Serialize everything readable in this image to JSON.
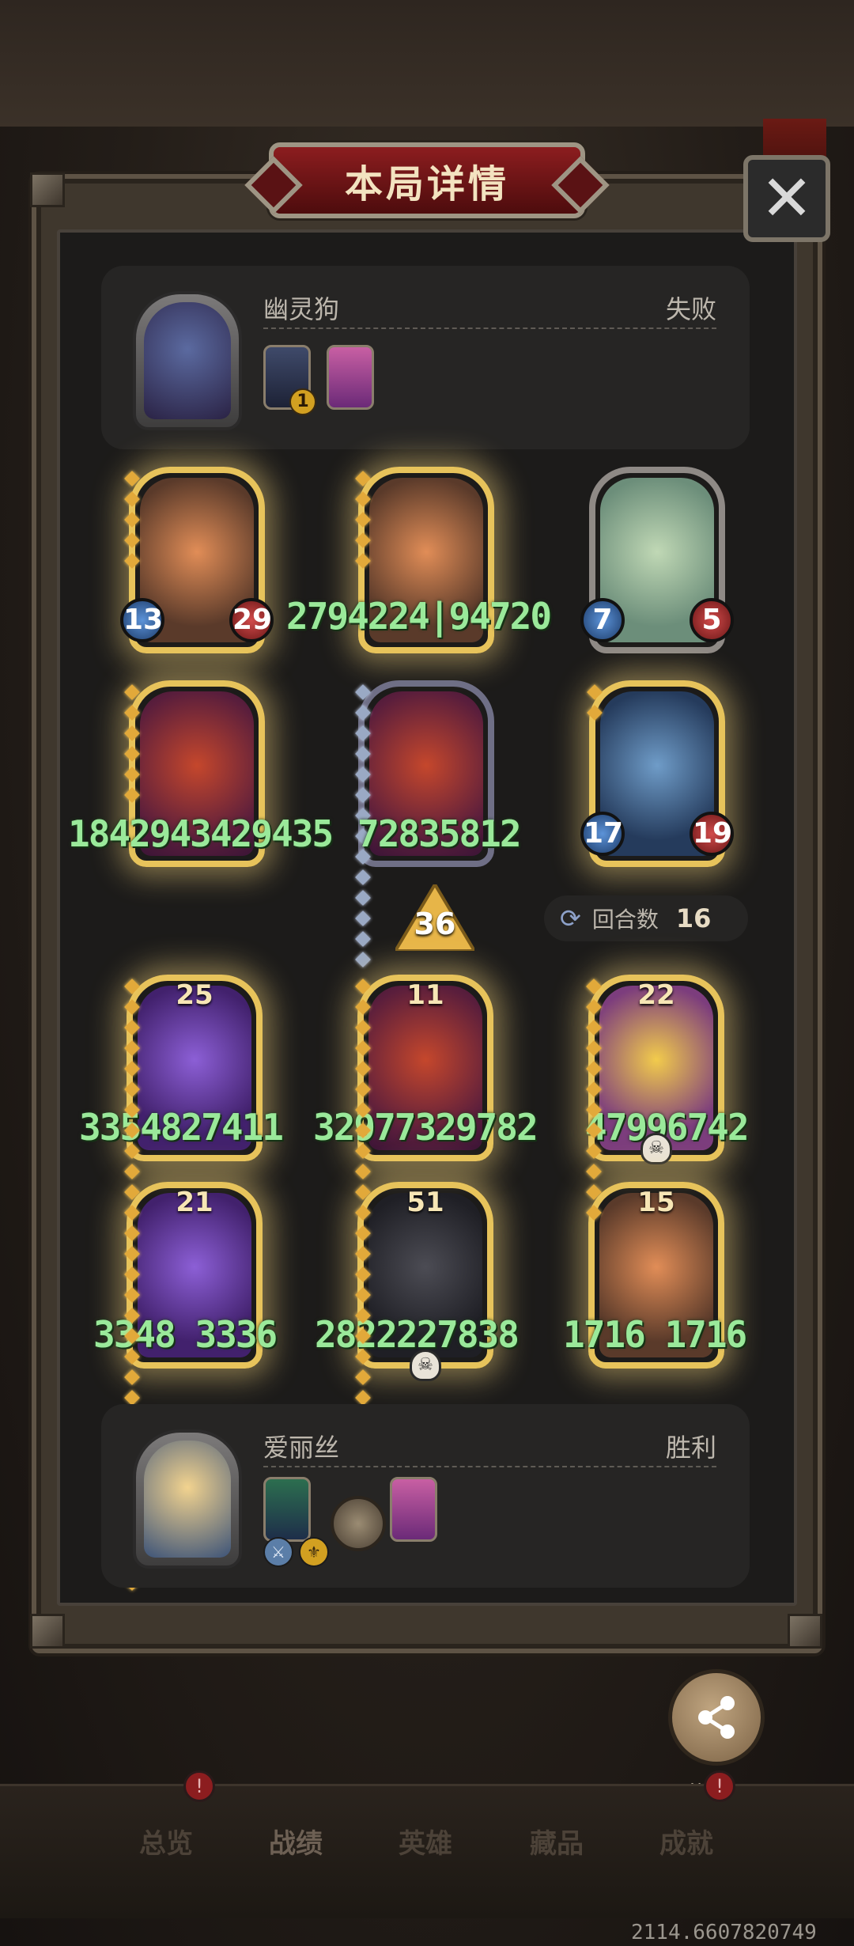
{
  "title": "本局详情",
  "close_icon": "✕",
  "opponent": {
    "name": "幽灵狗",
    "result": "失败",
    "mini_badge": "1"
  },
  "player": {
    "name": "爱丽丝",
    "result": "胜利"
  },
  "arrow_value": "36",
  "rounds": {
    "label": "回合数",
    "value": "16"
  },
  "enemy_cards": [
    {
      "atk": "13",
      "hp": "29",
      "stat_text": "13    29"
    },
    {
      "stat_text": "2794224|94720"
    },
    {
      "atk": "7",
      "hp": "5"
    },
    {
      "stat_text": "1842943429435"
    },
    {
      "stat_text": "72835812"
    },
    {
      "atk": "17",
      "hp": "19"
    }
  ],
  "my_cards": [
    {
      "level": "25",
      "stat_text": "3354827411"
    },
    {
      "level": "11",
      "stat_text": "32977329782"
    },
    {
      "level": "22",
      "stat_text": "47996742"
    },
    {
      "level": "21",
      "stat_text": "3348 3336"
    },
    {
      "level": "51",
      "stat_text": "2822227838"
    },
    {
      "level": "15",
      "stat_text": "1716  1716"
    }
  ],
  "share_label": "分享",
  "nav": [
    "总览",
    "战绩",
    "英雄",
    "藏品",
    "成就"
  ],
  "nav_active": "战绩",
  "nav_badge": "!",
  "build_id": "2114.6607820749"
}
